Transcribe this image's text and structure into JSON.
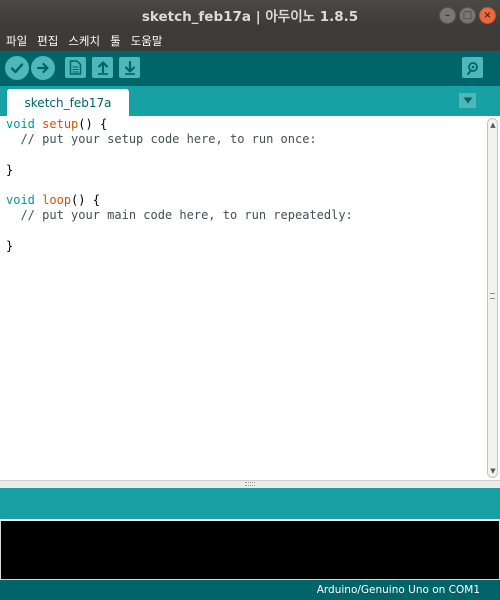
{
  "window": {
    "title": "sketch_feb17a | 아두이노 1.8.5",
    "minimize_glyph": "–",
    "maximize_glyph": "□",
    "close_glyph": "×"
  },
  "menubar": {
    "items": [
      "파일",
      "편집",
      "스케치",
      "툴",
      "도움말"
    ]
  },
  "toolbar": {
    "buttons": [
      "verify-icon",
      "upload-icon",
      "new-icon",
      "open-icon",
      "save-icon",
      "serial-monitor-icon"
    ]
  },
  "tabs": {
    "active_label": "sketch_feb17a",
    "menu_icon": "tab-menu-icon"
  },
  "editor": {
    "line1_kw": "void",
    "line1_fn": "setup",
    "line1_rest": "() {",
    "line2": "  // put your setup code here, to run once:",
    "line4": "}",
    "line6_kw": "void",
    "line6_fn": "loop",
    "line6_rest": "() {",
    "line7": "  // put your main code here, to run repeatedly:",
    "line9": "}"
  },
  "status": {
    "board_port": "Arduino/Genuino Uno on COM1"
  },
  "colors": {
    "teal_dark": "#006468",
    "teal_light": "#17a1a5",
    "button_fill": "#4db7bb",
    "keyword": "#00979c",
    "function": "#d35400"
  }
}
